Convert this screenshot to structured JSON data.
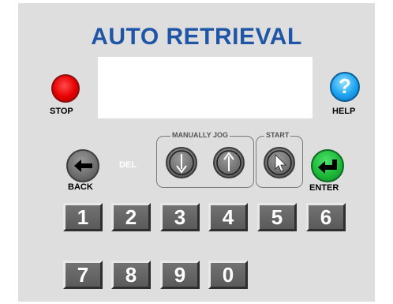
{
  "app": {
    "title": "AUTO RETRIEVAL"
  },
  "display": {
    "text": ""
  },
  "controls": {
    "stop_label": "STOP",
    "help_label": "HELP",
    "help_glyph": "?",
    "back_label": "BACK",
    "enter_label": "ENTER",
    "del_label": "DEL",
    "manual_jog_label": "MANUALLY JOG",
    "start_label": "START"
  },
  "keypad": {
    "row1": [
      "1",
      "2",
      "3",
      "4",
      "5",
      "6"
    ],
    "row2": [
      "7",
      "8",
      "9",
      "0"
    ]
  },
  "colors": {
    "title": "#1f55a6",
    "panel": "#dedede",
    "stop": "#e60000",
    "help": "#1ea3f0",
    "enter": "#1dbb3a",
    "key": "#656565"
  },
  "icons": {
    "stop": "stop-icon",
    "help": "help-icon",
    "back": "back-arrow-icon",
    "enter": "enter-arrow-icon",
    "jog_down": "arrow-down-icon",
    "jog_up": "arrow-up-icon",
    "start": "cursor-icon"
  }
}
